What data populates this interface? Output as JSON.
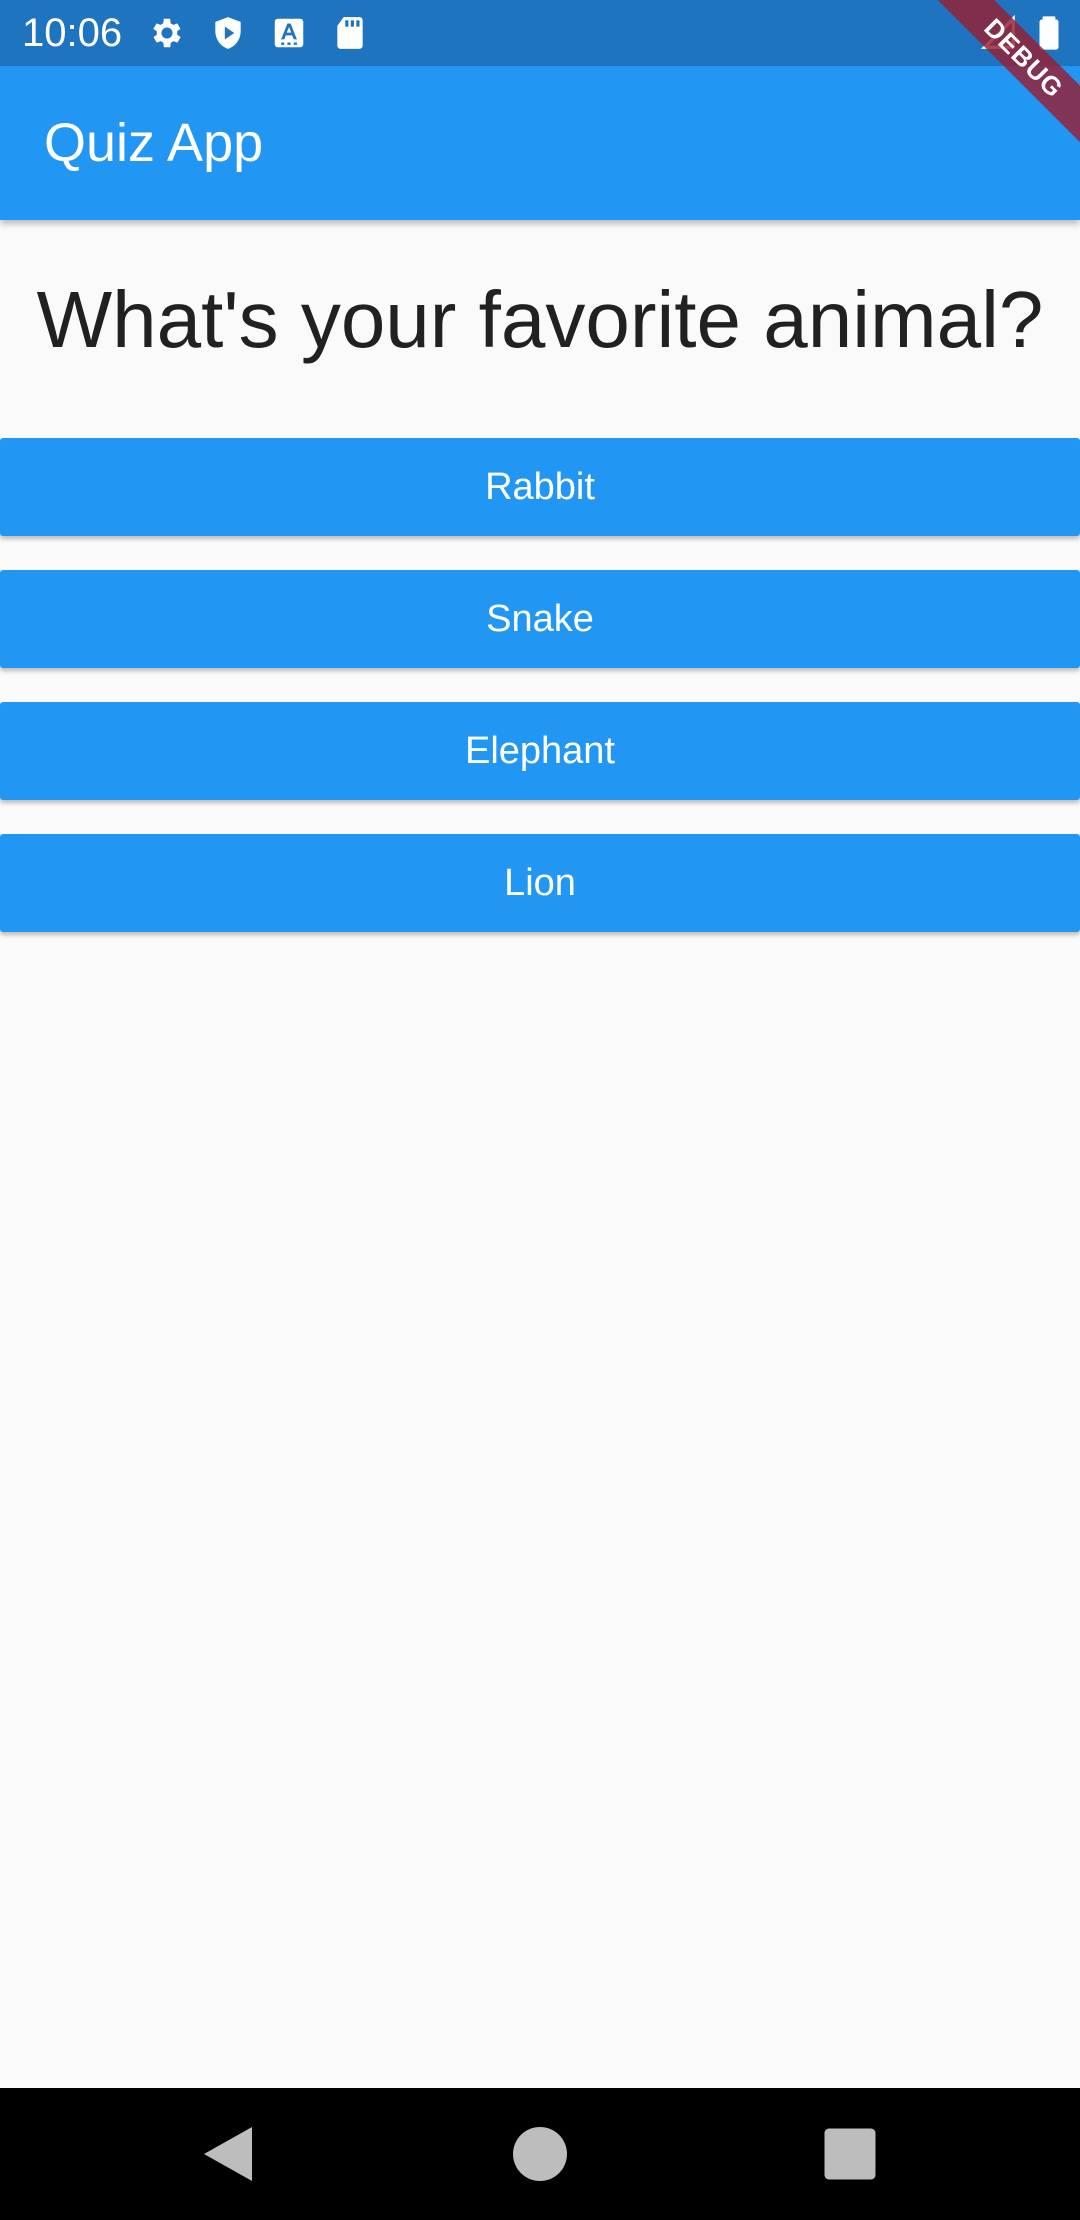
{
  "status_bar": {
    "time": "10:06",
    "icons": [
      "settings-icon",
      "shield-play-icon",
      "font-a-icon",
      "sd-card-icon",
      "signal-icon",
      "battery-icon"
    ]
  },
  "app_bar": {
    "title": "Quiz App"
  },
  "debug_banner": {
    "label": "DEBUG"
  },
  "quiz": {
    "question": "What's your favorite animal?",
    "answers": [
      {
        "label": "Rabbit"
      },
      {
        "label": "Snake"
      },
      {
        "label": "Elephant"
      },
      {
        "label": "Lion"
      }
    ]
  },
  "nav_bar": {
    "buttons": [
      "back-icon",
      "home-icon",
      "recents-icon"
    ]
  },
  "colors": {
    "status_bar": "#1f74c0",
    "primary": "#2196f3",
    "background": "#fafafa",
    "text_dark": "#212121",
    "debug_ribbon": "#961e32"
  }
}
